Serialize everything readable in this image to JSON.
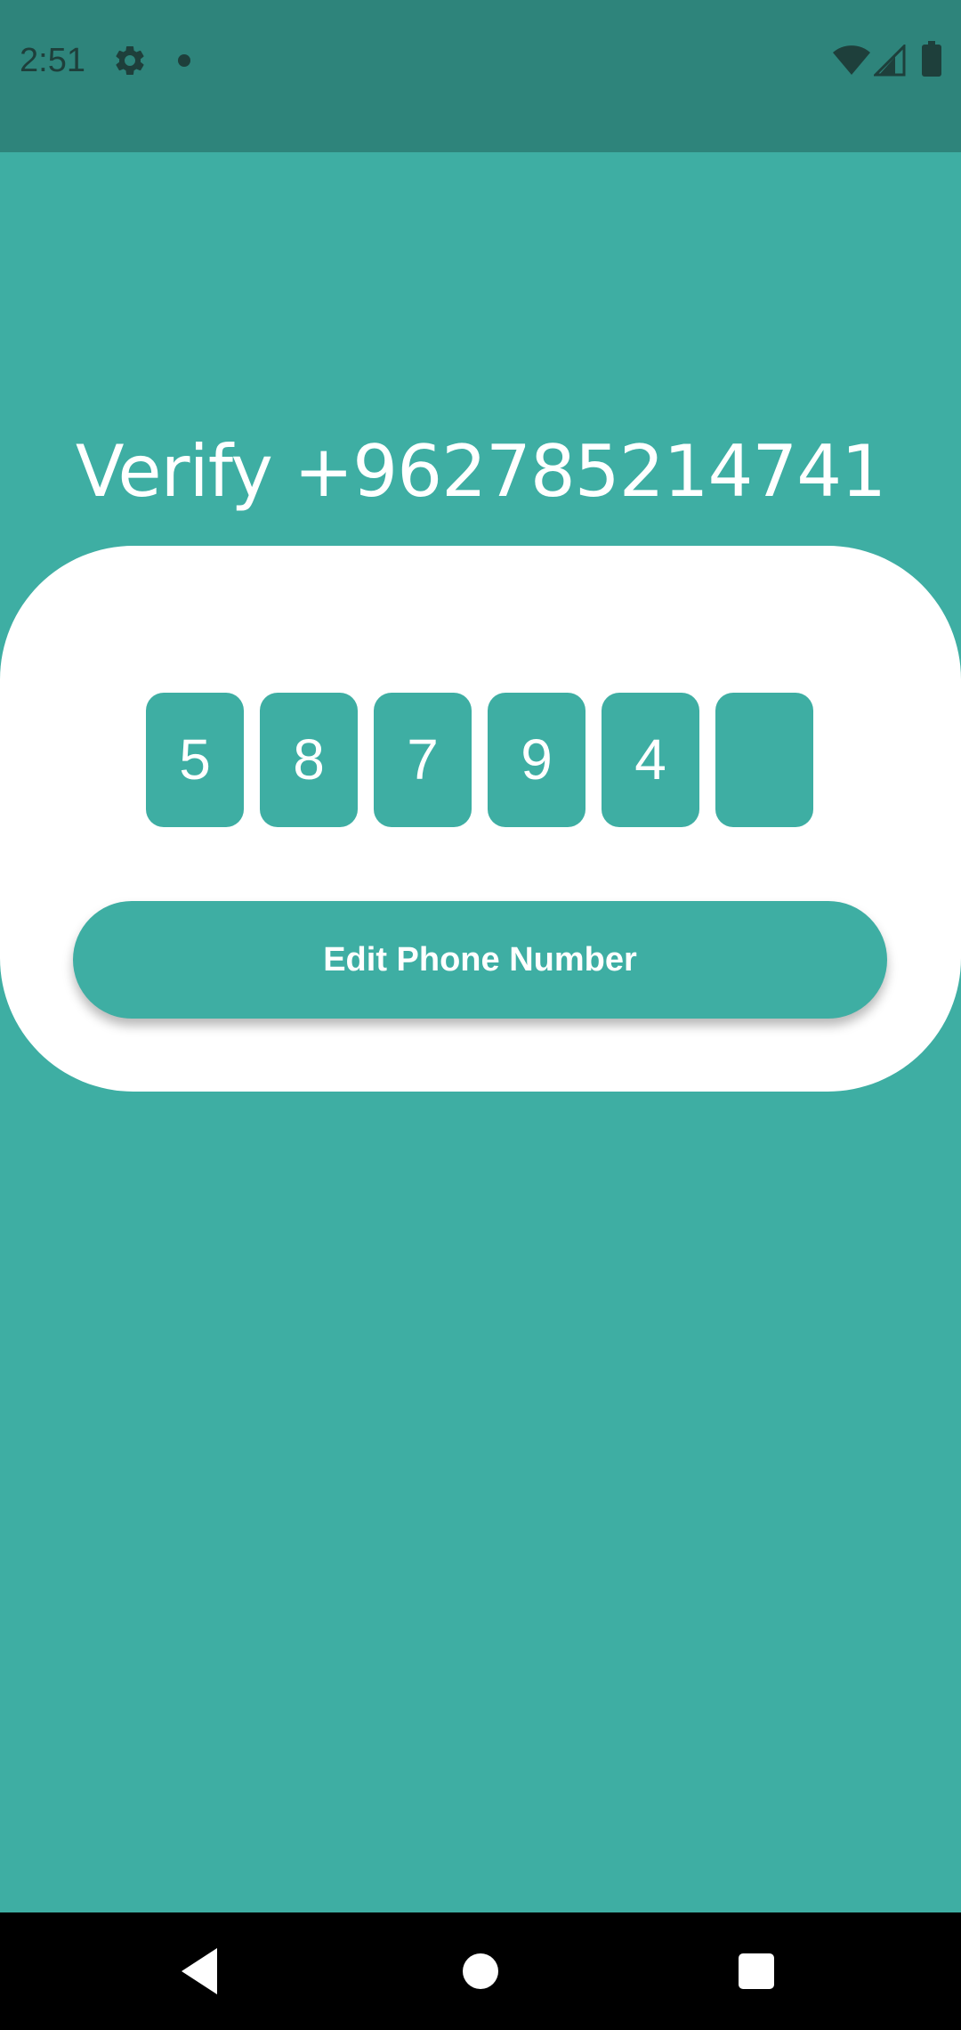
{
  "status_bar": {
    "time": "2:51",
    "icons": [
      "gear-icon",
      "dot-icon",
      "wifi-icon",
      "signal-icon",
      "battery-icon"
    ]
  },
  "verify": {
    "title": "Verify +962785214741",
    "otp_digits": [
      "5",
      "8",
      "7",
      "9",
      "4",
      ""
    ],
    "edit_button_label": "Edit Phone Number"
  },
  "colors": {
    "primary": "#3EAEA3",
    "status_bar": "#2E847B",
    "card": "#FFFFFF",
    "nav_bar": "#000000"
  },
  "nav_bar": {
    "icons": [
      "back-icon",
      "home-icon",
      "recents-icon"
    ]
  }
}
